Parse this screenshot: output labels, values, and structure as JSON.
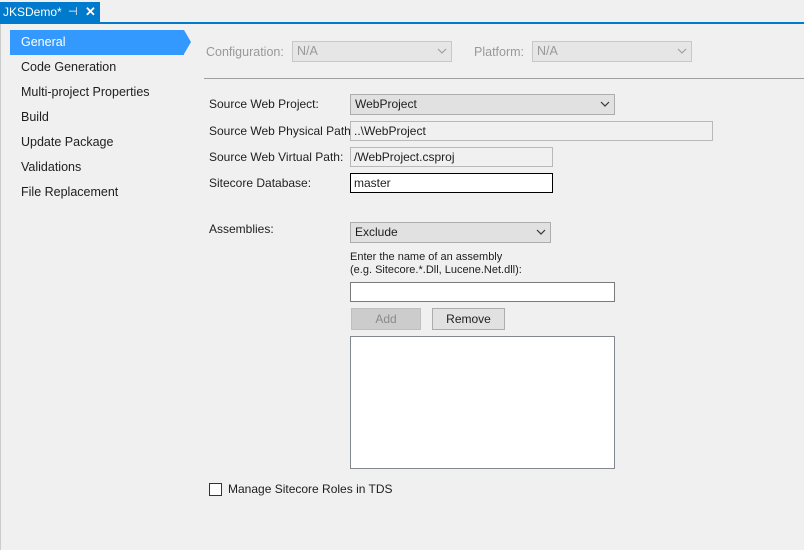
{
  "tab": {
    "title": "JKSDemo*",
    "pin_glyph": "⊣",
    "close_glyph": "✕"
  },
  "nav": {
    "items": [
      {
        "label": "General",
        "selected": true
      },
      {
        "label": "Code Generation"
      },
      {
        "label": "Multi-project Properties"
      },
      {
        "label": "Build"
      },
      {
        "label": "Update Package"
      },
      {
        "label": "Validations"
      },
      {
        "label": "File Replacement"
      }
    ]
  },
  "toolbar": {
    "configuration_label": "Configuration:",
    "configuration_value": "N/A",
    "platform_label": "Platform:",
    "platform_value": "N/A"
  },
  "form": {
    "source_web_project_label": "Source Web Project:",
    "source_web_project_value": "WebProject",
    "physical_path_label": "Source Web Physical Path:",
    "physical_path_value": "..\\WebProject",
    "virtual_path_label": "Source Web Virtual Path:",
    "virtual_path_value": "/WebProject.csproj",
    "database_label": "Sitecore Database:",
    "database_value": "master",
    "assemblies_label": "Assemblies:",
    "assemblies_value": "Exclude",
    "assembly_hint_line1": "Enter the name of an assembly",
    "assembly_hint_line2": "(e.g. Sitecore.*.Dll, Lucene.Net.dll):",
    "assembly_name_value": "",
    "add_label": "Add",
    "remove_label": "Remove",
    "manage_roles_label": "Manage Sitecore Roles in TDS",
    "manage_roles_checked": false
  },
  "colors": {
    "accent": "#007acc",
    "selection": "#3399ff",
    "background": "#f0f0f0"
  }
}
